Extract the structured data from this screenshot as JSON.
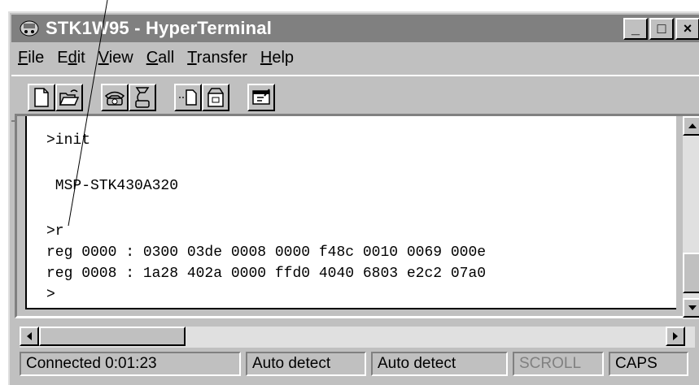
{
  "window": {
    "title": "STK1W95 - HyperTerminal",
    "minimize_glyph": "_",
    "maximize_glyph": "□",
    "close_glyph": "×"
  },
  "menu": [
    {
      "accel": "F",
      "rest": "ile"
    },
    {
      "pre": "E",
      "accel": "d",
      "rest": "it"
    },
    {
      "accel": "V",
      "rest": "iew"
    },
    {
      "accel": "C",
      "rest": "all"
    },
    {
      "accel": "T",
      "rest": "ransfer"
    },
    {
      "accel": "H",
      "rest": "elp"
    }
  ],
  "toolbar": {
    "icons": [
      "new-icon",
      "open-icon",
      "connect-icon",
      "disconnect-icon",
      "send-icon",
      "receive-icon",
      "properties-icon"
    ]
  },
  "terminal": {
    "lines": [
      ">init",
      "",
      " MSP-STK430A320",
      "",
      ">r",
      "reg 0000 : 0300 03de 0008 0000 f48c 0010 0069 000e",
      "reg 0008 : 1a28 402a 0000 ffd0 4040 6803 e2c2 07a0",
      ">"
    ]
  },
  "status": {
    "connected": "Connected 0:01:23",
    "emulation": "Auto detect",
    "port_settings": "Auto detect",
    "scroll": "SCROLL",
    "caps": "CAPS"
  },
  "colors": {
    "titlebar_inactive": "#808080",
    "face": "#c0c0c0",
    "terminal_bg": "#ffffff"
  }
}
